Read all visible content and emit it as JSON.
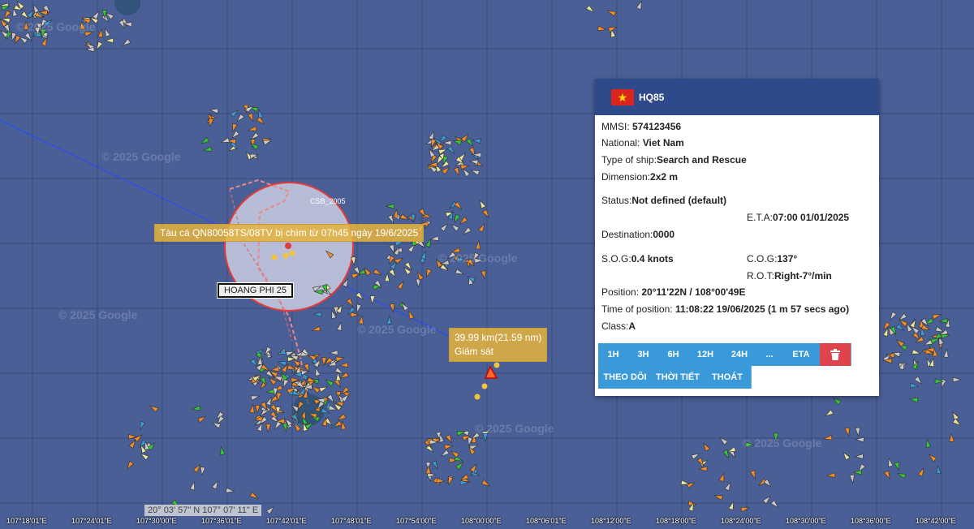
{
  "map": {
    "watermark": "© 2025 Google",
    "alert_label": "Tàu cá QN80058TS/08TV bị chìm từ 07h45 ngày 19/6/2025",
    "vessel_name_box": "HOANG PHI 25",
    "csb_label": "CSB_2005",
    "distance_label": "39.99 km(21.59 nm)",
    "monitor_label": "Giám sát",
    "cursor_latlon": "20° 03' 57\" N 107° 07' 11\" E",
    "longitude_ticks": [
      "107°18'01\"E",
      "107°24'01\"E",
      "107°30'00\"E",
      "107°36'01\"E",
      "107°42'01\"E",
      "107°48'01\"E",
      "107°54'00\"E",
      "108°00'00\"E",
      "108°06'01\"E",
      "108°12'00\"E",
      "108°18'00\"E",
      "108°24'00\"E",
      "108°30'00\"E",
      "108°36'00\"E",
      "108°42'00\"E"
    ]
  },
  "panel": {
    "flag_star": "★",
    "ship_name": "HQ85",
    "mmsi_label": "MMSI:",
    "mmsi": "574123456",
    "national_label": "National:",
    "national": "Viet Nam",
    "type_label": "Type of ship:",
    "type": "Search and Rescue",
    "dimension_label": "Dimension:",
    "dimension": "2x2 m",
    "status_label": "Status:",
    "status": "Not defined (default)",
    "eta_label": "E.T.A:",
    "eta": "07:00 01/01/2025",
    "destination_label": "Destination:",
    "destination": "0000",
    "sog_label": "S.O.G:",
    "sog": "0.4 knots",
    "cog_label": "C.O.G:",
    "cog": "137°",
    "rot_label": "R.O.T:",
    "rot": "Right-7°/min",
    "position_label": "Position:",
    "position": "20°11'22N / 108°00'49E",
    "time_label": "Time of position:",
    "time": "11:08:22 19/06/2025 (1 m 57 secs ago)",
    "class_label": "Class:",
    "class": "A",
    "buttons": [
      "1H",
      "3H",
      "6H",
      "12H",
      "24H",
      "...",
      "ETA"
    ],
    "buttons2": [
      "THEO DÕI",
      "THỜI TIẾT",
      "THOÁT"
    ],
    "delete_icon": "trash-icon"
  }
}
